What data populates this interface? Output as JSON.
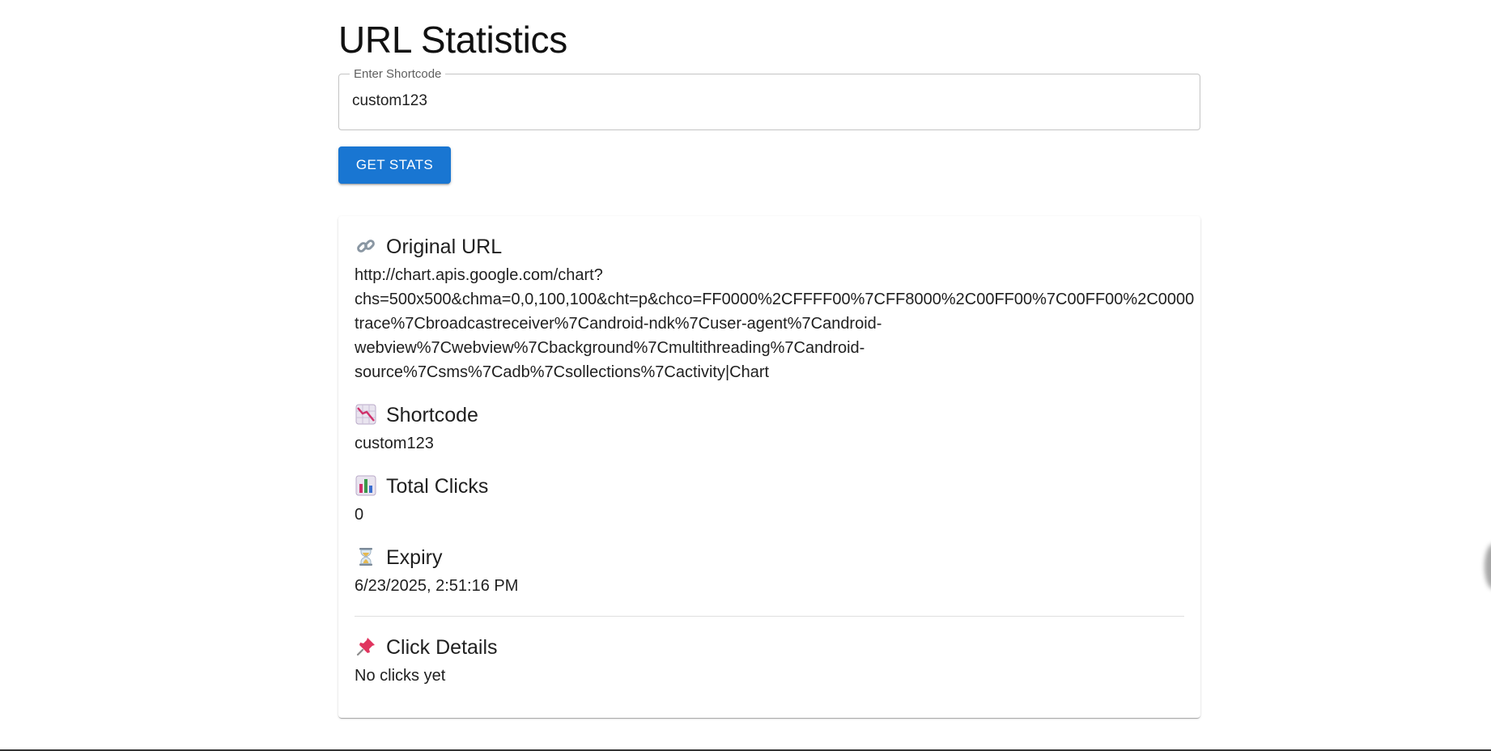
{
  "page": {
    "title": "URL Statistics"
  },
  "form": {
    "label": "Enter Shortcode",
    "value": "custom123",
    "button_label": "GET STATS"
  },
  "stats": {
    "original_url": {
      "icon": "link-icon",
      "heading": "Original URL",
      "lines": [
        "http://chart.apis.google.com/chart?",
        "chs=500x500&chma=0,0,100,100&cht=p&chco=FF0000%2CFFFF00%7CFF8000%2C00FF00%7C00FF00%2C0000",
        "trace%7Cbroadcastreceiver%7Candroid-ndk%7Cuser-agent%7Candroid-",
        "webview%7Cwebview%7Cbackground%7Cmultithreading%7Candroid-",
        "source%7Csms%7Cadb%7Csollections%7Cactivity|Chart"
      ]
    },
    "shortcode": {
      "icon": "chart-decreasing-icon",
      "heading": "Shortcode",
      "value": "custom123"
    },
    "total_clicks": {
      "icon": "bar-chart-icon",
      "heading": "Total Clicks",
      "value": "0"
    },
    "expiry": {
      "icon": "hourglass-icon",
      "heading": "Expiry",
      "value": "6/23/2025, 2:51:16 PM"
    },
    "click_details": {
      "icon": "pushpin-icon",
      "heading": "Click Details",
      "value": "No clicks yet"
    }
  },
  "colors": {
    "primary": "#1976d2",
    "border": "#c4c4c4",
    "divider": "#e0e0e0"
  }
}
